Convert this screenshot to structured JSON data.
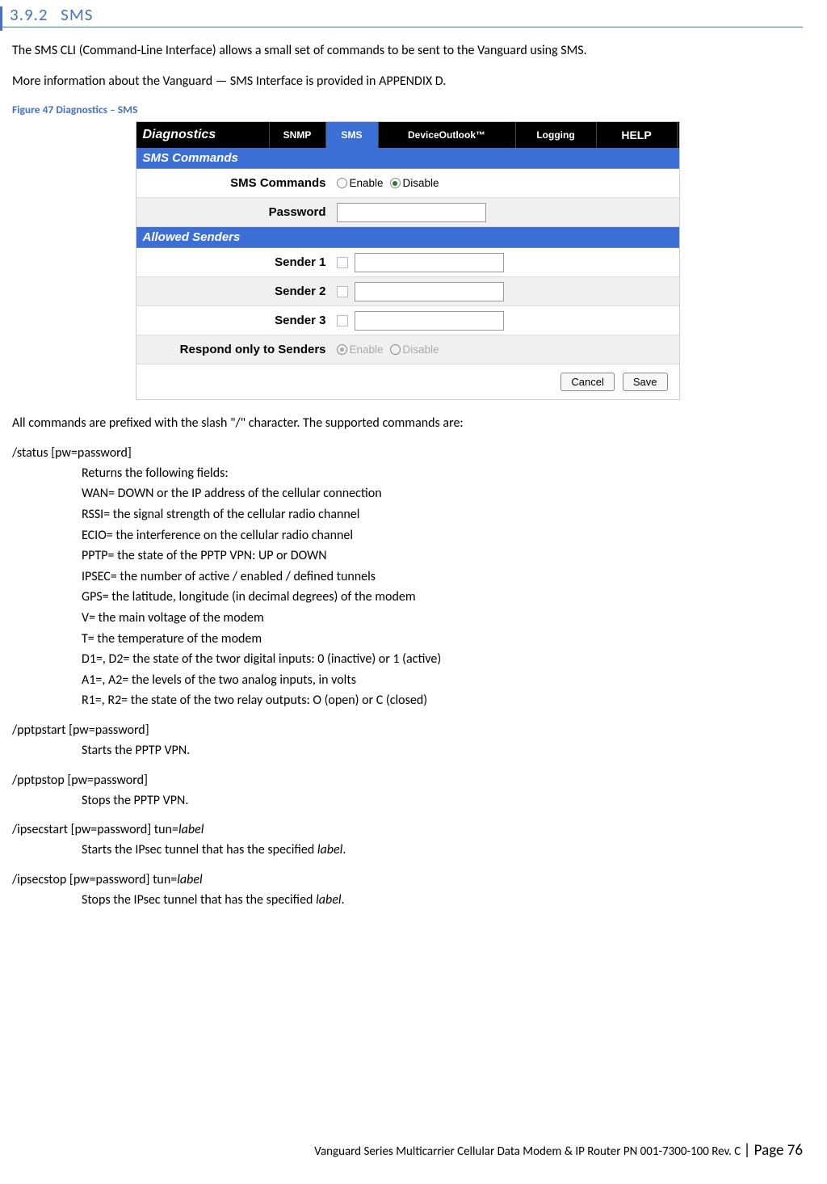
{
  "heading": {
    "number": "3.9.2",
    "title": "SMS"
  },
  "intro1": "The SMS CLI (Command-Line Interface) allows a small set of commands to be sent to the Vanguard  using SMS.",
  "intro2": "More information about the Vanguard  — SMS Interface is provided in APPENDIX D.",
  "figure_caption": "Figure 47 Diagnostics – SMS",
  "screenshot": {
    "tabs": {
      "main": "Diagnostics",
      "snmp": "SNMP",
      "sms": "SMS",
      "outlook": "DeviceOutlook™",
      "logging": "Logging",
      "help": "HELP"
    },
    "section1": "SMS Commands",
    "section2": "Allowed Senders",
    "labels": {
      "sms_commands": "SMS Commands",
      "password": "Password",
      "sender1": "Sender 1",
      "sender2": "Sender 2",
      "sender3": "Sender 3",
      "respond": "Respond only to Senders"
    },
    "radio": {
      "enable": "Enable",
      "disable": "Disable"
    },
    "buttons": {
      "cancel": "Cancel",
      "save": "Save"
    }
  },
  "para_commands": "All commands are prefixed with the slash \"/\" character. The supported commands are:",
  "commands": {
    "status": {
      "name": "/status [pw=password]",
      "lines": [
        "Returns the following fields:",
        "WAN= DOWN or the IP address of the cellular connection",
        "RSSI= the signal strength of the cellular radio channel",
        "ECIO= the interference on the cellular radio channel",
        "PPTP= the state of the PPTP VPN: UP or DOWN",
        "IPSEC= the number of active / enabled / defined tunnels",
        "GPS= the latitude, longitude (in decimal degrees) of the modem",
        "V= the main voltage of the modem",
        "T= the temperature of the modem",
        "D1=, D2= the state of the twor digital inputs: 0 (inactive) or 1 (active)",
        "A1=, A2= the levels of the two analog inputs, in volts",
        "R1=, R2= the state of the two relay outputs: O (open) or C (closed)"
      ]
    },
    "pptpstart": {
      "name": "/pptpstart [pw=password]",
      "lines": [
        "Starts the PPTP VPN."
      ]
    },
    "pptpstop": {
      "name": "/pptpstop [pw=password]",
      "lines": [
        "Stops the PPTP VPN."
      ]
    },
    "ipsecstart": {
      "name_prefix": "/ipsecstart [pw=password] tun=",
      "name_italic": "label",
      "line_prefix": "Starts the IPsec tunnel that has the specified ",
      "line_italic": "label",
      "line_suffix": "."
    },
    "ipsecstop": {
      "name_prefix": "/ipsecstop [pw=password] tun=",
      "name_italic": "label",
      "line_prefix": "Stops the IPsec tunnel that has the specified ",
      "line_italic": "label",
      "line_suffix": "."
    }
  },
  "footer": {
    "text": "Vanguard Series Multicarrier Cellular Data Modem & IP Router PN 001-7300-100 Rev. C ",
    "page": "| Page 76"
  }
}
